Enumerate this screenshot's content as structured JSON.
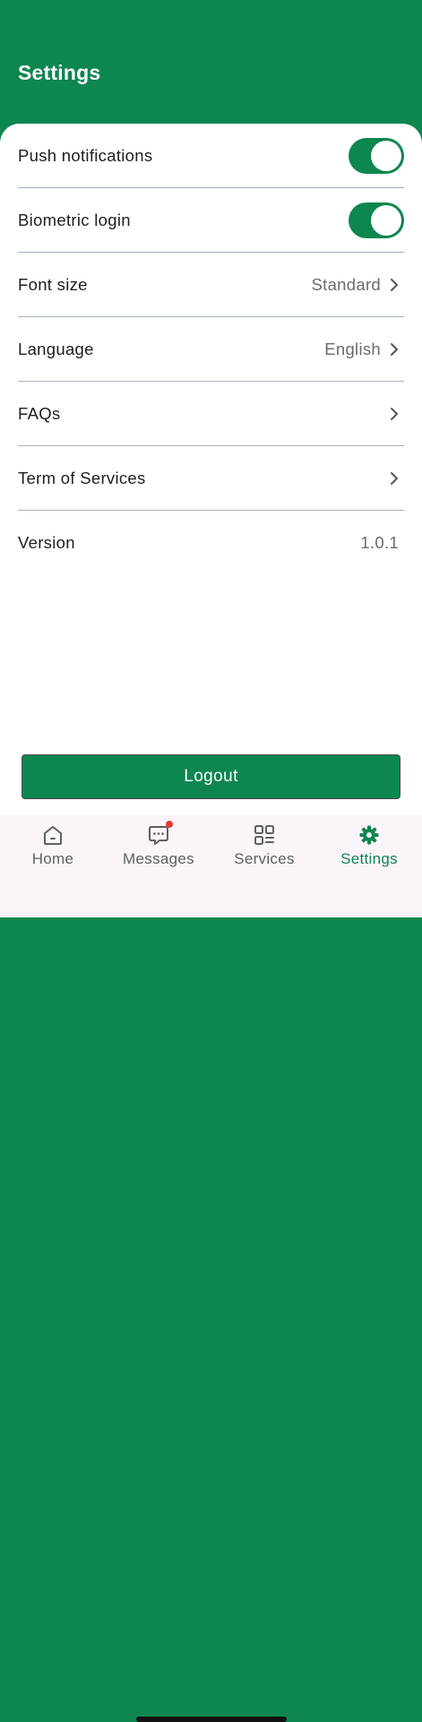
{
  "header": {
    "title": "Settings"
  },
  "settings": {
    "push_notifications": {
      "label": "Push notifications",
      "enabled": true
    },
    "biometric_login": {
      "label": "Biometric login",
      "enabled": true
    },
    "font_size": {
      "label": "Font size",
      "value": "Standard"
    },
    "language": {
      "label": "Language",
      "value": "English"
    },
    "faqs": {
      "label": "FAQs"
    },
    "terms": {
      "label": "Term of Services"
    },
    "version": {
      "label": "Version",
      "value": "1.0.1"
    }
  },
  "logout_label": "Logout",
  "tabs": [
    {
      "label": "Home",
      "icon": "home-icon",
      "active": false
    },
    {
      "label": "Messages",
      "icon": "message-icon",
      "active": false,
      "badge": true
    },
    {
      "label": "Services",
      "icon": "services-grid-icon",
      "active": false
    },
    {
      "label": "Settings",
      "icon": "gear-icon",
      "active": true
    }
  ],
  "colors": {
    "brand_green": "#0e8650",
    "badge_red": "#e53935",
    "tabbar_bg": "#fcf4fb"
  }
}
